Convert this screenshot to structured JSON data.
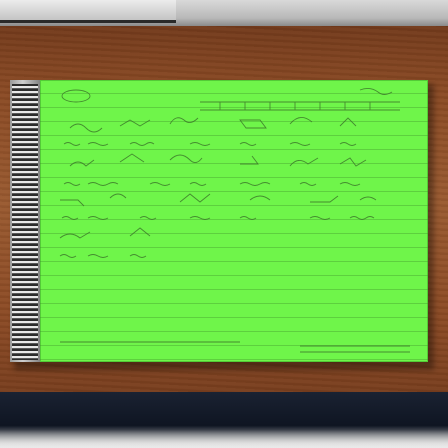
{
  "scene": {
    "colors": {
      "page": "#6ff54a",
      "desk": "#8a4a24",
      "ink": "#3d7a2b",
      "binding": "#cfcfcf"
    }
  }
}
